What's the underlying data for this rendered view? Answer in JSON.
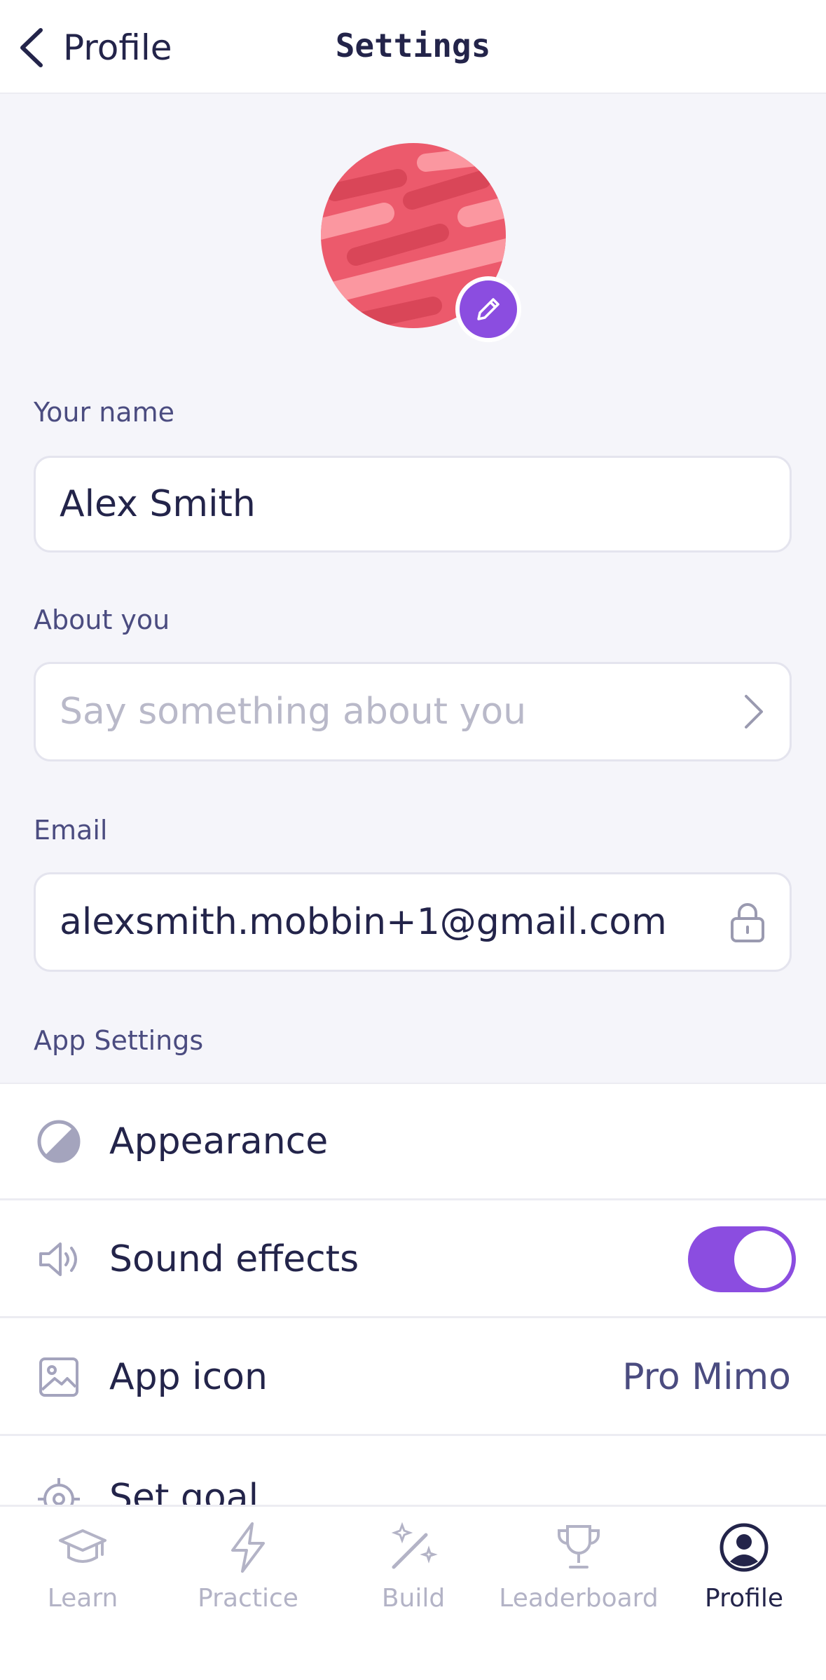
{
  "header": {
    "back_label": "Profile",
    "title": "Settings"
  },
  "profile": {
    "name_label": "Your name",
    "name_value": "Alex Smith",
    "about_label": "About you",
    "about_placeholder": "Say something about you",
    "email_label": "Email",
    "email_value": "alexsmith.mobbin+1@gmail.com"
  },
  "app_settings": {
    "heading": "App Settings",
    "items": [
      {
        "label": "Appearance",
        "icon": "half-circle-icon"
      },
      {
        "label": "Sound effects",
        "icon": "speaker-icon",
        "toggle_on": true
      },
      {
        "label": "App icon",
        "icon": "image-icon",
        "value": "Pro Mimo"
      },
      {
        "label": "Set goal",
        "icon": "target-icon"
      }
    ]
  },
  "tabbar": {
    "tabs": [
      {
        "label": "Learn",
        "icon": "graduation-cap-icon"
      },
      {
        "label": "Practice",
        "icon": "lightning-icon"
      },
      {
        "label": "Build",
        "icon": "magic-wand-icon"
      },
      {
        "label": "Leaderboard",
        "icon": "trophy-icon"
      },
      {
        "label": "Profile",
        "icon": "user-circle-icon",
        "active": true
      }
    ]
  },
  "colors": {
    "accent": "#8b4de0",
    "text": "#23244a",
    "muted": "#4b4c80",
    "background": "#f5f5fa",
    "avatar": "#ec5a6c"
  }
}
